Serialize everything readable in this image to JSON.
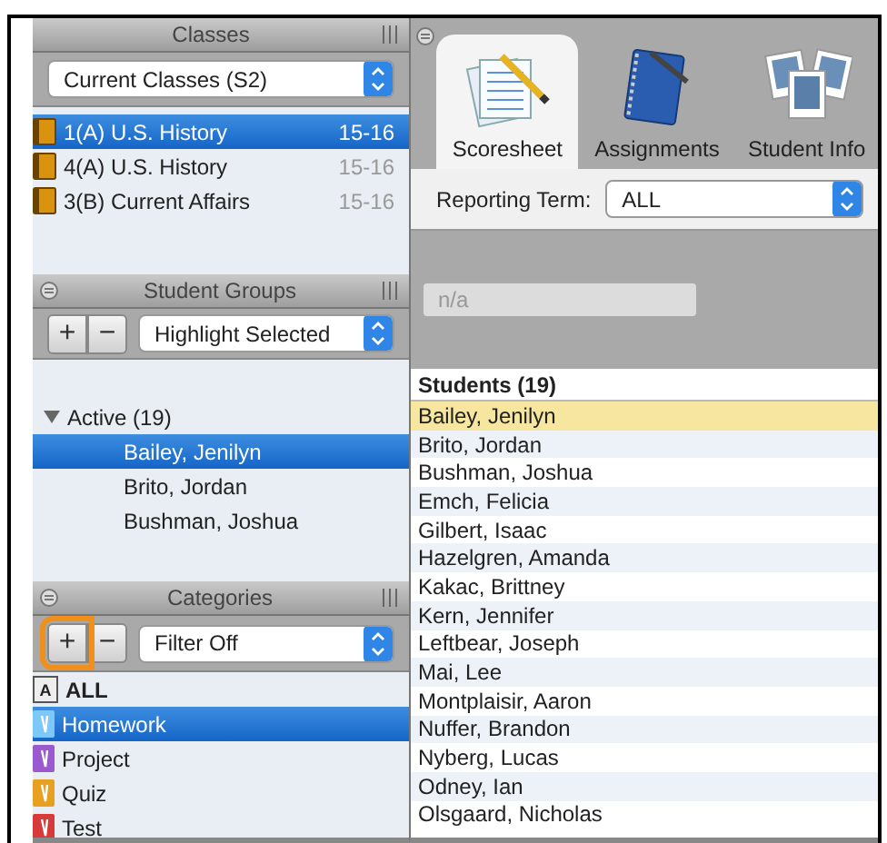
{
  "classes": {
    "title": "Classes",
    "filter": "Current Classes (S2)",
    "items": [
      {
        "name": "1(A) U.S. History",
        "year": "15-16",
        "selected": true
      },
      {
        "name": "4(A) U.S. History",
        "year": "15-16",
        "selected": false
      },
      {
        "name": "3(B) Current Affairs",
        "year": "15-16",
        "selected": false
      }
    ]
  },
  "student_groups": {
    "title": "Student Groups",
    "add": "+",
    "remove": "−",
    "filter": "Highlight Selected",
    "groups": [
      {
        "label": "Active (19)",
        "expanded": true,
        "children": [
          {
            "name": "Bailey, Jenilyn",
            "selected": true
          },
          {
            "name": "Brito, Jordan",
            "selected": false
          },
          {
            "name": "Bushman, Joshua",
            "selected": false
          }
        ]
      }
    ]
  },
  "categories": {
    "title": "Categories",
    "add": {
      "label": "+",
      "highlighted": true
    },
    "remove": {
      "label": "−",
      "highlighted": false
    },
    "filter": "Filter Off",
    "items": [
      {
        "name": "ALL",
        "kind": "all",
        "badge": "A",
        "selected": false
      },
      {
        "name": "Homework",
        "kind": "category",
        "color": "#7cc8f8",
        "selected": true
      },
      {
        "name": "Project",
        "kind": "category",
        "color": "#9b59d0",
        "selected": false
      },
      {
        "name": "Quiz",
        "kind": "category",
        "color": "#e8a020",
        "selected": false
      },
      {
        "name": "Test",
        "kind": "category",
        "color": "#d83a3a",
        "selected": false
      }
    ]
  },
  "tabs": [
    {
      "label": "Scoresheet",
      "kind": "scoresheet",
      "selected": true
    },
    {
      "label": "Assignments",
      "kind": "assignments",
      "selected": false
    },
    {
      "label": "Student Info",
      "kind": "student_info",
      "selected": false
    }
  ],
  "reporting_term": {
    "label": "Reporting Term:",
    "value": "ALL"
  },
  "score_field": {
    "value": "n/a",
    "disabled": true
  },
  "students": {
    "title": "Students (19)",
    "rows": [
      {
        "name": "Bailey, Jenilyn",
        "highlighted": true
      },
      {
        "name": "Brito, Jordan",
        "highlighted": false
      },
      {
        "name": "Bushman, Joshua",
        "highlighted": false
      },
      {
        "name": "Emch, Felicia",
        "highlighted": false
      },
      {
        "name": "Gilbert, Isaac",
        "highlighted": false
      },
      {
        "name": "Hazelgren, Amanda",
        "highlighted": false
      },
      {
        "name": "Kakac, Brittney",
        "highlighted": false
      },
      {
        "name": "Kern, Jennifer",
        "highlighted": false
      },
      {
        "name": "Leftbear, Joseph",
        "highlighted": false
      },
      {
        "name": "Mai, Lee",
        "highlighted": false
      },
      {
        "name": "Montplaisir, Aaron",
        "highlighted": false
      },
      {
        "name": "Nuffer, Brandon",
        "highlighted": false
      },
      {
        "name": "Nyberg, Lucas",
        "highlighted": false
      },
      {
        "name": "Odney, Ian",
        "highlighted": false
      },
      {
        "name": "Olsgaard, Nicholas",
        "highlighted": false
      }
    ]
  }
}
